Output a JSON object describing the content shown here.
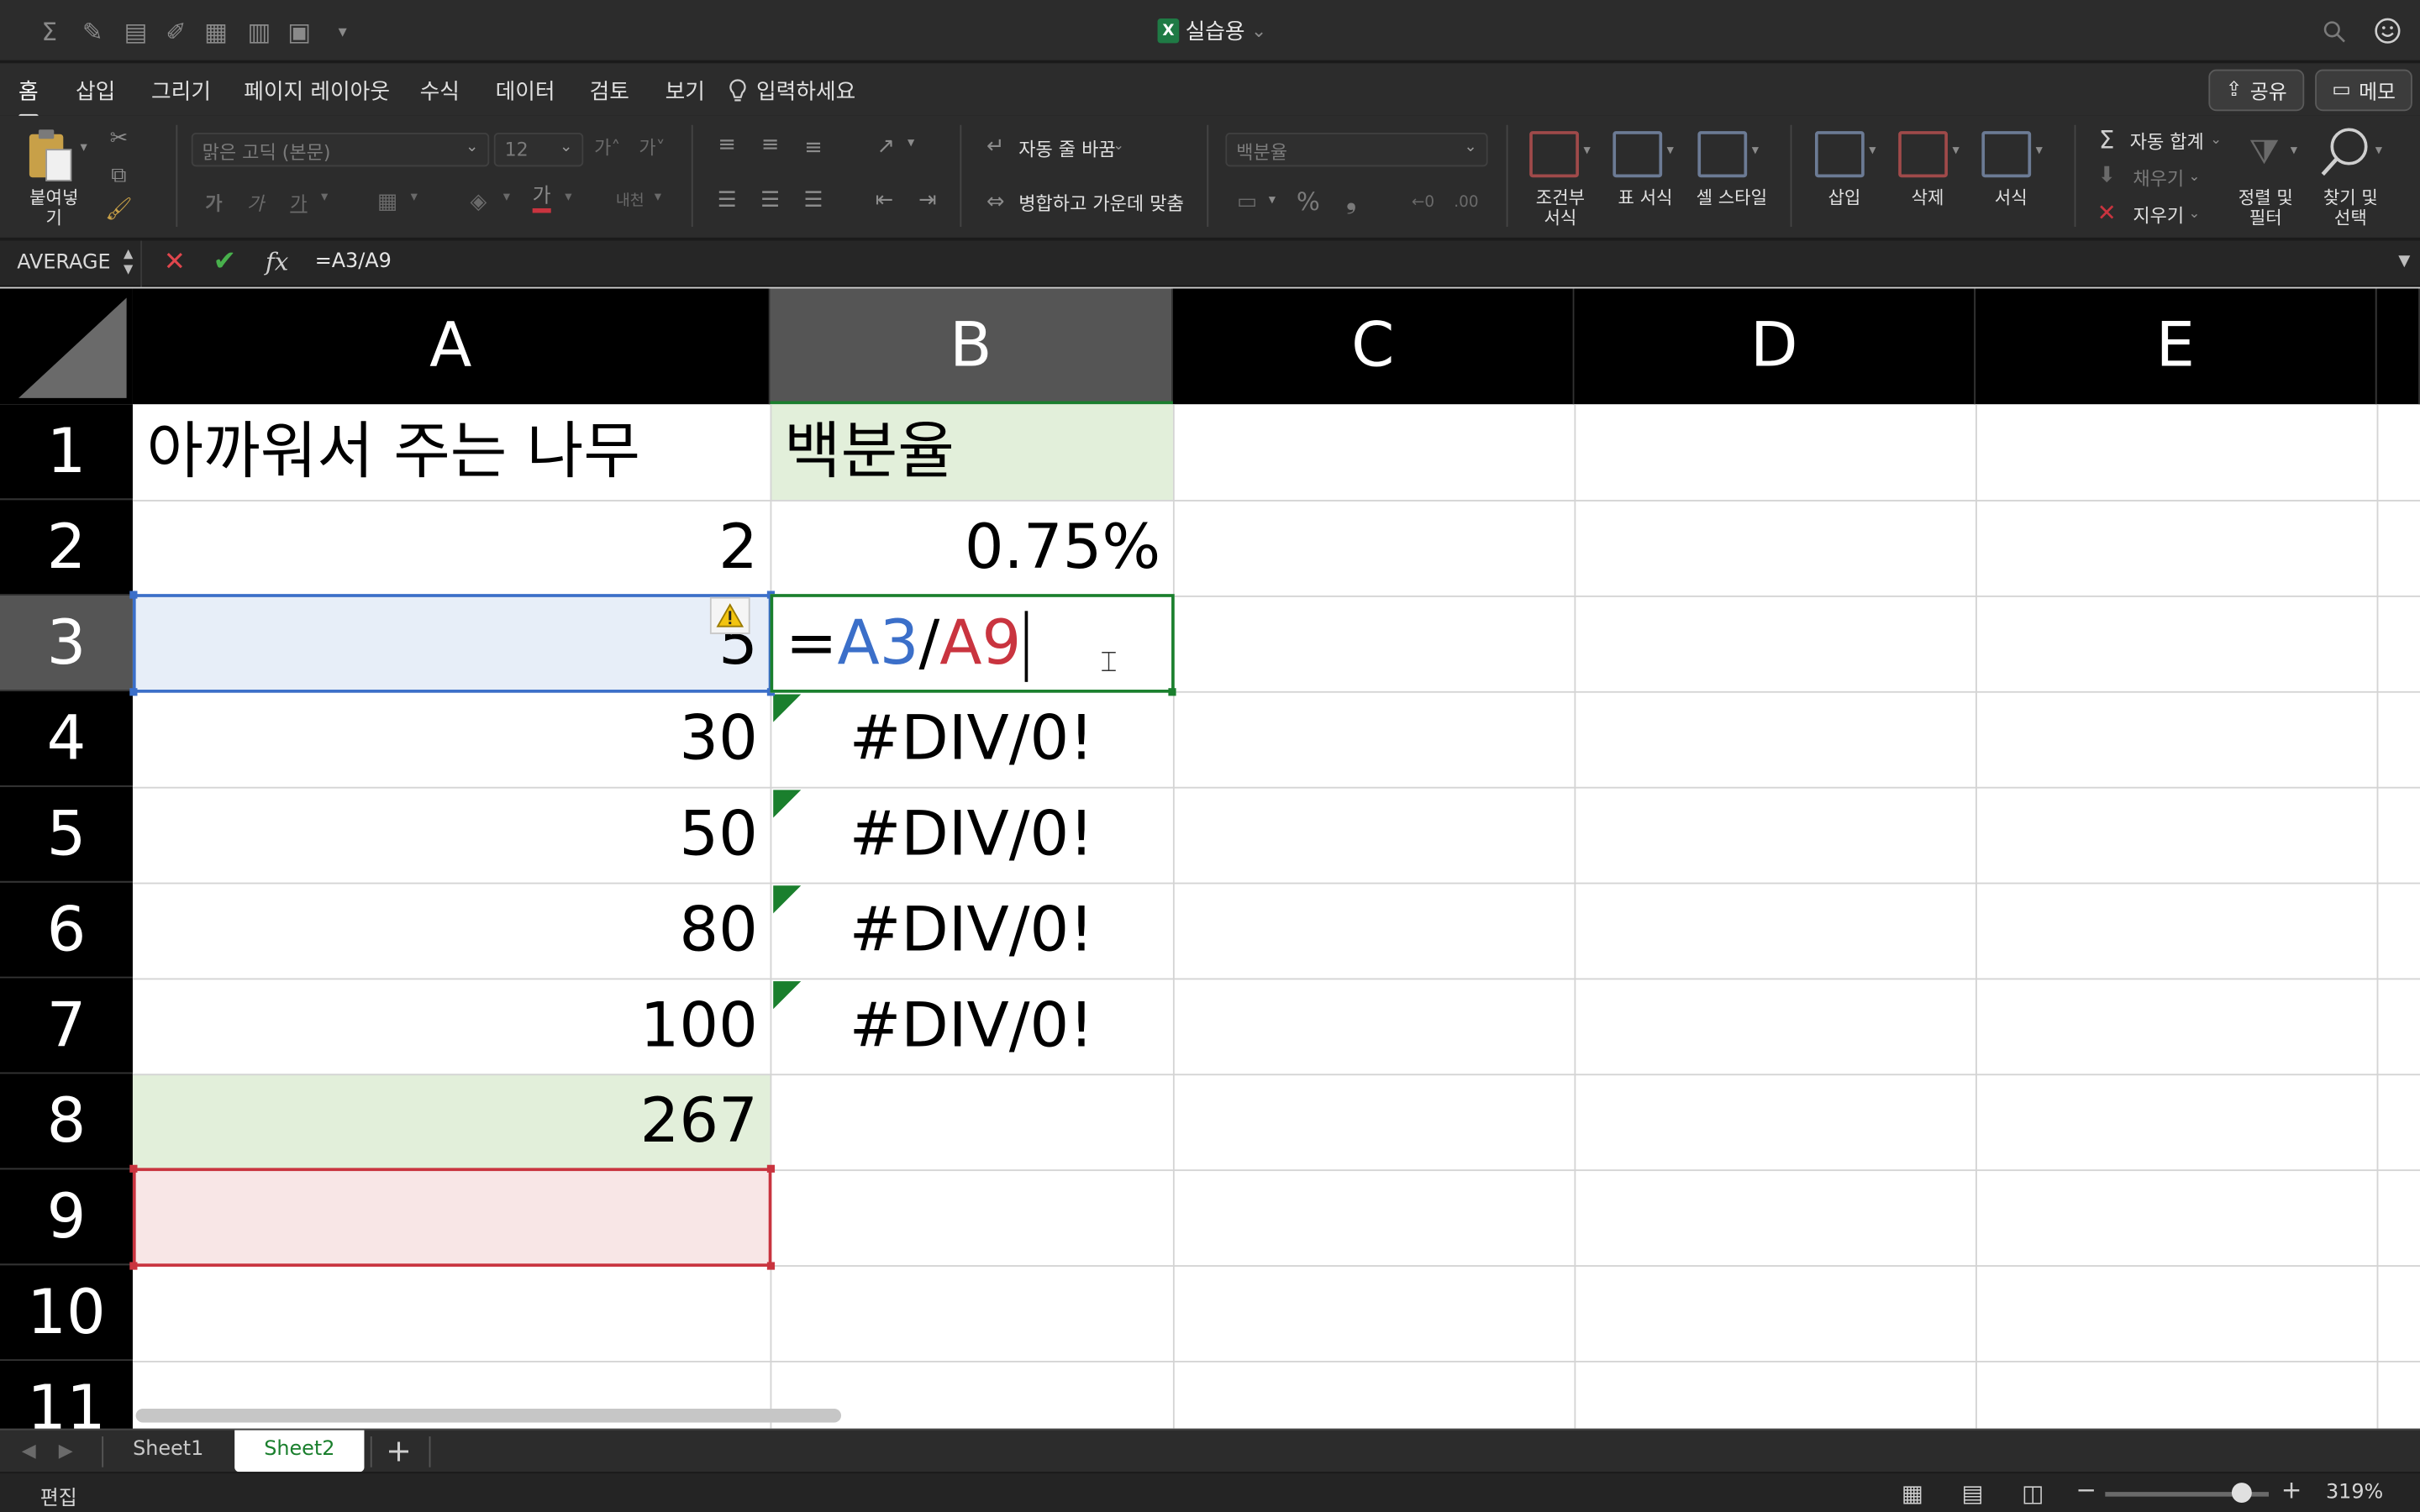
{
  "title_bar": {
    "doc_title": "실습용",
    "chevron": "⌄"
  },
  "ribbon_tabs": [
    "홈",
    "삽입",
    "그리기",
    "페이지 레이아웃",
    "수식",
    "데이터",
    "검토",
    "보기",
    "입력하세요"
  ],
  "top_buttons": {
    "share": "공유",
    "memo": "메모"
  },
  "ribbon": {
    "paste": "붙여넣기",
    "font_name": "맑은 고딕 (본문)",
    "font_size": "12",
    "wrap_text": "자동 줄 바꿈",
    "merge_center": "병합하고 가운데 맞춤",
    "number_format": "백분율",
    "conditional_format": [
      "조건부",
      "서식"
    ],
    "table_format": "표 서식",
    "cell_style": "셀 스타일",
    "insert": "삽입",
    "delete": "삭제",
    "format": "서식",
    "autosum": "자동 합계",
    "fill": "채우기",
    "clear": "지우기",
    "sort_filter": [
      "정렬 및",
      "필터"
    ],
    "find_select": [
      "찾기 및",
      "선택"
    ],
    "font_glyphs": {
      "bold": "가",
      "italic": "가",
      "underline": "가",
      "grow": "가˄",
      "shrink": "가˅",
      "color_a": "가",
      "phonetic": "내천",
      "percent": "%",
      "comma": "❟"
    }
  },
  "formula_bar": {
    "name_box": "AVERAGE",
    "formula": "=A3/A9",
    "fx": "fx"
  },
  "columns": [
    "A",
    "B",
    "C",
    "D",
    "E"
  ],
  "rows": [
    "1",
    "2",
    "3",
    "4",
    "5",
    "6",
    "7",
    "8",
    "9",
    "10",
    "11"
  ],
  "cells": {
    "A1": "아까워서 주는 나무",
    "B1": "백분율",
    "A2": "2",
    "B2": "0.75%",
    "A3": "5",
    "B3_eq": "=",
    "B3_ref1": "A3",
    "B3_slash": "/",
    "B3_ref2": "A9",
    "A4": "30",
    "B4": "#DIV/0!",
    "A5": "50",
    "B5": "#DIV/0!",
    "A6": "80",
    "B6": "#DIV/0!",
    "A7": "100",
    "B7": "#DIV/0!",
    "A8": "267"
  },
  "sheet_tabs": [
    "Sheet1",
    "Sheet2"
  ],
  "active_sheet": "Sheet2",
  "status": {
    "mode": "편집",
    "zoom": "319%"
  },
  "colors": {
    "ref1": "#3b6fc9",
    "ref2": "#c9343f",
    "green_fill": "#e2efda",
    "blue_fill": "#e7eef8",
    "red_fill": "#f8e6e6",
    "error_triangle": "#1a7f2d"
  }
}
